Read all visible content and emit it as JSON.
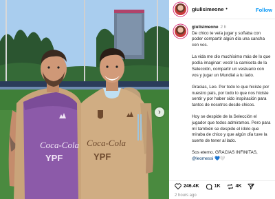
{
  "post": {
    "username": "giulisimeone",
    "follow_label": "Follow",
    "time_short": "2 h",
    "paragraphs": [
      "De chico te veía jugar y soñaba con poder compartir algún día una cancha con vos.",
      "La vida me dio muchísimo más de lo que podía imaginar: vestir la camiseta de la Selección, compartir un vestuario con vos y jugar un Mundial a tu lado.",
      "Gracias, Leo. Por todo lo que hiciste por nuestro país, por todo lo que nos hiciste sentir y por haber sido inspiración para tantos de nosotros desde chicos.",
      "Hoy se despide de la Selección el jugador que todos admiramos. Pero para mí también se despide el ídolo que miraba de chico y que algún día tuve la suerte de tener al lado."
    ],
    "last_paragraph": "Sos eterno. GRACIAS INFINITAS,",
    "mention": "@leomessi",
    "mention_suffix": " 💙🤍",
    "likes": "246.4K",
    "comments": "1K",
    "reposts": "4K",
    "time_long": "2 hours ago"
  },
  "photo": {
    "jersey_left_text_1": "Coca-Cola",
    "jersey_left_text_2": "YPF",
    "jersey_right_text_1": "Coca-Cola",
    "jersey_right_text_2": "YPF",
    "colors": {
      "sky": "#9ec3e6",
      "trees": "#2f5a32",
      "pitch": "#3f7f3a",
      "bib": "#8a5aa8",
      "jersey": "#c9a77e"
    }
  },
  "icons": {
    "like": "heart-icon",
    "comment": "comment-icon",
    "repost": "repost-icon",
    "share": "share-icon",
    "next": "chevron-right-icon"
  }
}
